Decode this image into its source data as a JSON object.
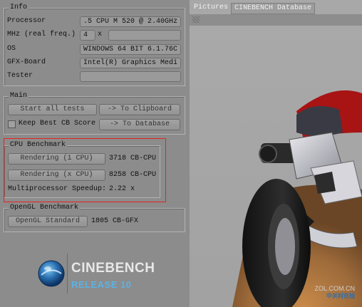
{
  "info": {
    "title": "Info",
    "processor_label": "Processor",
    "processor_value": ".5 CPU M 520 @ 2.40GHz",
    "mhz_label": "MHz (real freq.)",
    "cores_value": "4",
    "multiplier": "x",
    "os_label": "OS",
    "os_value": "WINDOWS 64 BIT 6.1.76C",
    "gfx_label": "GFX-Board",
    "gfx_value": "Intel(R) Graphics Medi",
    "tester_label": "Tester"
  },
  "main": {
    "title": "Main",
    "start_all": "Start all tests",
    "to_clipboard": "-> To Clipboard",
    "keep_best": "Keep Best CB Score",
    "to_database": "-> To Database"
  },
  "cpu": {
    "title": "CPU Benchmark",
    "render_1cpu": "Rendering (1 CPU)",
    "score_1cpu": "3718 CB-CPU",
    "render_xcpu": "Rendering (x CPU)",
    "score_xcpu": "8258 CB-CPU",
    "speedup_label": "Multiprocessor Speedup:",
    "speedup_value": "2.22 x"
  },
  "opengl": {
    "title": "OpenGL Benchmark",
    "standard": "OpenGL Standard",
    "score": "1805 CB-GFX"
  },
  "logo": {
    "name": "CINEBENCH",
    "release": "RELEASE 10"
  },
  "tabs": {
    "pictures": "Pictures",
    "database": "CINEBENCH Database"
  },
  "watermark": {
    "site": "ZOL.COM.CN",
    "brand": "中关村在线"
  },
  "colors": {
    "highlight": "#e52323",
    "release_blue": "#5bb3e6"
  }
}
